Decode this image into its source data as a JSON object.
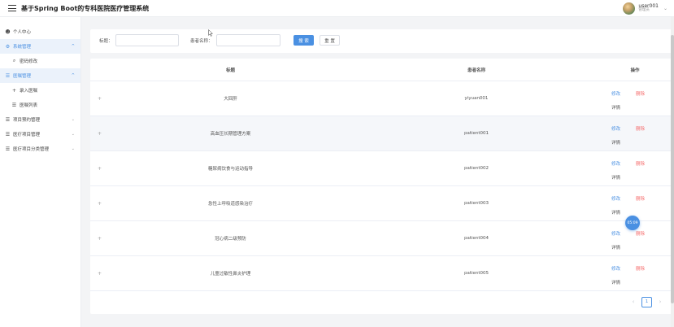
{
  "header": {
    "title": "基于Spring Boot的专科医院医疗管理系统",
    "user_name": "user001",
    "user_role": "管理员"
  },
  "sidebar": {
    "items": [
      {
        "label": "个人中心",
        "icon": "user-icon"
      },
      {
        "label": "系统管理",
        "icon": "gear-icon"
      },
      {
        "label": "密码修改",
        "icon": "key-icon"
      },
      {
        "label": "医嘱管理",
        "icon": "list-icon"
      },
      {
        "label": "录入医嘱",
        "icon": "plus-icon"
      },
      {
        "label": "医嘱列表",
        "icon": "list-icon"
      },
      {
        "label": "项目预约管理",
        "icon": "list-icon"
      },
      {
        "label": "医疗项目管理",
        "icon": "list-icon"
      },
      {
        "label": "医疗项目分类管理",
        "icon": "list-icon"
      }
    ]
  },
  "search": {
    "title_label": "标题：",
    "title_value": "",
    "patient_label": "患者名称：",
    "patient_value": "",
    "search_button": "搜 索",
    "reset_button": "重 置"
  },
  "table": {
    "columns": [
      "标题",
      "患者名称",
      "操作"
    ],
    "expand_symbol": "+",
    "rows": [
      {
        "title": "大回肝",
        "patient": "yiyuan001"
      },
      {
        "title": "高血压长期管理方案",
        "patient": "patient001"
      },
      {
        "title": "糖尿病饮食与运动指导",
        "patient": "patient002"
      },
      {
        "title": "急性上呼吸道感染治疗",
        "patient": "patient003"
      },
      {
        "title": "冠心病二级预防",
        "patient": "patient004"
      },
      {
        "title": "儿童过敏性鼻炎护理",
        "patient": "patient005"
      }
    ],
    "actions": {
      "edit": "修改",
      "delete": "删除",
      "detail": "详情"
    }
  },
  "pagination": {
    "prev": "‹",
    "current": "1",
    "next": "›"
  },
  "timer": "05:09",
  "colors": {
    "accent": "#4a90e2",
    "danger": "#f56c6c",
    "active_bg": "#ebf2fb"
  }
}
